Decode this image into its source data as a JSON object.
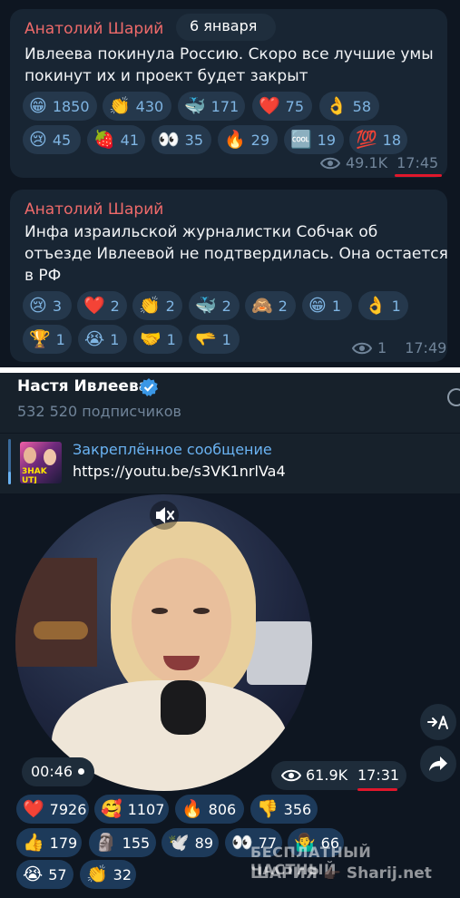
{
  "msg1": {
    "author": "Анатолий Шарий",
    "date_badge": "6 января",
    "text_line1": "Ивлеева покинула Россию. Скоро все лучшие умы",
    "text_line2": "покинут их и проект будет закрыт",
    "reactions": [
      {
        "emoji": "😁",
        "count": "1850"
      },
      {
        "emoji": "👏",
        "count": "430"
      },
      {
        "emoji": "🐳",
        "count": "171"
      },
      {
        "emoji": "❤️",
        "count": "75"
      },
      {
        "emoji": "👌",
        "count": "58"
      },
      {
        "emoji": "😢",
        "count": "45"
      },
      {
        "emoji": "🍓",
        "count": "41"
      },
      {
        "emoji": "👀",
        "count": "35"
      },
      {
        "emoji": "🔥",
        "count": "29"
      },
      {
        "emoji": "🆒",
        "count": "19"
      },
      {
        "emoji": "💯",
        "count": "18"
      }
    ],
    "views": "49.1K",
    "time": "17:45"
  },
  "msg2": {
    "author": "Анатолий Шарий",
    "text_line1": "Инфа израильской журналистки Собчак об",
    "text_line2": "отъезде Ивлеевой не подтвердилась. Она остается",
    "text_line3": "в РФ",
    "reactions": [
      {
        "emoji": "😢",
        "count": "3"
      },
      {
        "emoji": "❤️",
        "count": "2"
      },
      {
        "emoji": "👏",
        "count": "2"
      },
      {
        "emoji": "🐳",
        "count": "2"
      },
      {
        "emoji": "🙈",
        "count": "2"
      },
      {
        "emoji": "😁",
        "count": "1"
      },
      {
        "emoji": "👌",
        "count": "1"
      },
      {
        "emoji": "🏆",
        "count": "1"
      },
      {
        "emoji": "😭",
        "count": "1"
      },
      {
        "emoji": "🤝",
        "count": "1"
      },
      {
        "emoji": "🫳",
        "count": "1"
      }
    ],
    "views": "1",
    "time": "17:49"
  },
  "channel": {
    "name": "Настя Ивлеева",
    "subscribers": "532 520 подписчиков",
    "pinned_title": "Закреплённое сообщение",
    "pinned_link": "https://youtu.be/s3VK1nrlVa4",
    "thumb_text": "3HAK UTJ"
  },
  "video": {
    "duration": "00:46",
    "views": "61.9K",
    "time": "17:31",
    "reactions": [
      {
        "emoji": "❤️",
        "count": "7926"
      },
      {
        "emoji": "🥰",
        "count": "1107"
      },
      {
        "emoji": "🔥",
        "count": "806"
      },
      {
        "emoji": "👎",
        "count": "356"
      },
      {
        "emoji": "👍",
        "count": "179"
      },
      {
        "emoji": "🗿",
        "count": "155"
      },
      {
        "emoji": "🕊️",
        "count": "89"
      },
      {
        "emoji": "👀",
        "count": "77"
      },
      {
        "emoji": "🤷‍♂️",
        "count": "66"
      },
      {
        "emoji": "😭",
        "count": "57"
      },
      {
        "emoji": "👏",
        "count": "32"
      }
    ]
  },
  "watermark": {
    "line1": "БЕСПЛАТНЫЙ ЧАСТНЫЙ",
    "line2_left": "ШАРИЯ",
    "line2_icon": "👉🏿",
    "line2_right": "Sharij.net"
  },
  "colors": {
    "background": "#0e1621",
    "bubble": "#182533",
    "author": "#ee6a6a",
    "link": "#6ab3f3",
    "underline": "#e0172b"
  }
}
